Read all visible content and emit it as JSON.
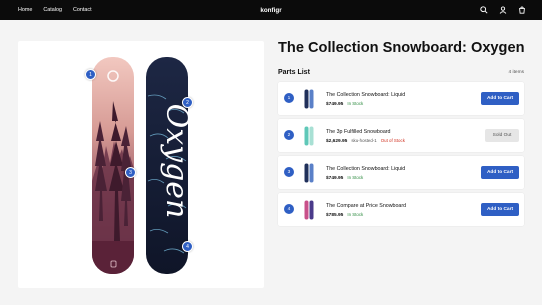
{
  "header": {
    "nav": [
      "Home",
      "Catalog",
      "Contact"
    ],
    "brand": "konfigr",
    "icons": [
      "search-icon",
      "account-icon",
      "cart-icon"
    ]
  },
  "product": {
    "title": "The Collection Snowboard: Oxygen",
    "board_text": "Oxygen",
    "hotspots": [
      "1",
      "2",
      "3",
      "4"
    ]
  },
  "parts": {
    "heading": "Parts List",
    "count": "4 items",
    "items": [
      {
        "index": "1",
        "name": "The Collection Snowboard: Liquid",
        "price": "$749.95",
        "sku": "",
        "stock": "In Stock",
        "button": "Add to Cart",
        "thumb": "liquid"
      },
      {
        "index": "2",
        "name": "The 3p Fulfilled Snowboard",
        "price": "$2,629.95",
        "sku": "sku-hosted-1",
        "stock": "Out of Stock",
        "button": "Sold Out",
        "thumb": "fulfilled"
      },
      {
        "index": "3",
        "name": "The Collection Snowboard: Liquid",
        "price": "$749.95",
        "sku": "",
        "stock": "In Stock",
        "button": "Add to Cart",
        "thumb": "liquid"
      },
      {
        "index": "4",
        "name": "The Compare at Price Snowboard",
        "price": "$785.95",
        "sku": "",
        "stock": "In Stock",
        "button": "Add to Cart",
        "thumb": "compare"
      }
    ]
  },
  "colors": {
    "accent": "#2f5fc4",
    "in_stock": "#2b8a3e",
    "out_of_stock": "#d03020",
    "header_bg": "#0b0b0b"
  }
}
